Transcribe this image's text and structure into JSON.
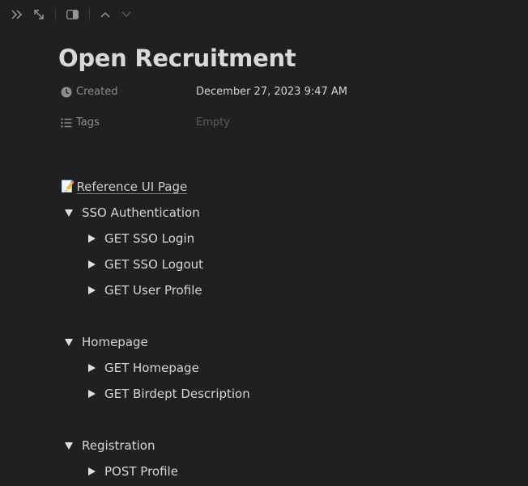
{
  "toolbar": {
    "icons": [
      "double-chevron-right-icon",
      "expand-arrows-icon",
      "sidebar-panel-icon",
      "chevron-up-icon",
      "chevron-down-icon"
    ]
  },
  "page": {
    "title": "Open Recruitment",
    "properties": {
      "created": {
        "label": "Created",
        "value": "December 27, 2023 9:47 AM"
      },
      "tags": {
        "label": "Tags",
        "value": "Empty"
      }
    }
  },
  "content": {
    "reference_link": {
      "emoji": "📝",
      "label": "Reference UI Page"
    },
    "sections": [
      {
        "label": "SSO Authentication",
        "expanded": true,
        "items": [
          "GET SSO Login",
          "GET SSO Logout",
          "GET User Profile"
        ]
      },
      {
        "label": "Homepage",
        "expanded": true,
        "items": [
          "GET Homepage",
          "GET Birdept Description"
        ]
      },
      {
        "label": "Registration",
        "expanded": true,
        "items": [
          "POST Profile"
        ]
      }
    ]
  },
  "colors": {
    "background": "#202020",
    "text": "#d6d6d6",
    "muted": "#8d8d8d",
    "empty": "#5c5c5c"
  }
}
